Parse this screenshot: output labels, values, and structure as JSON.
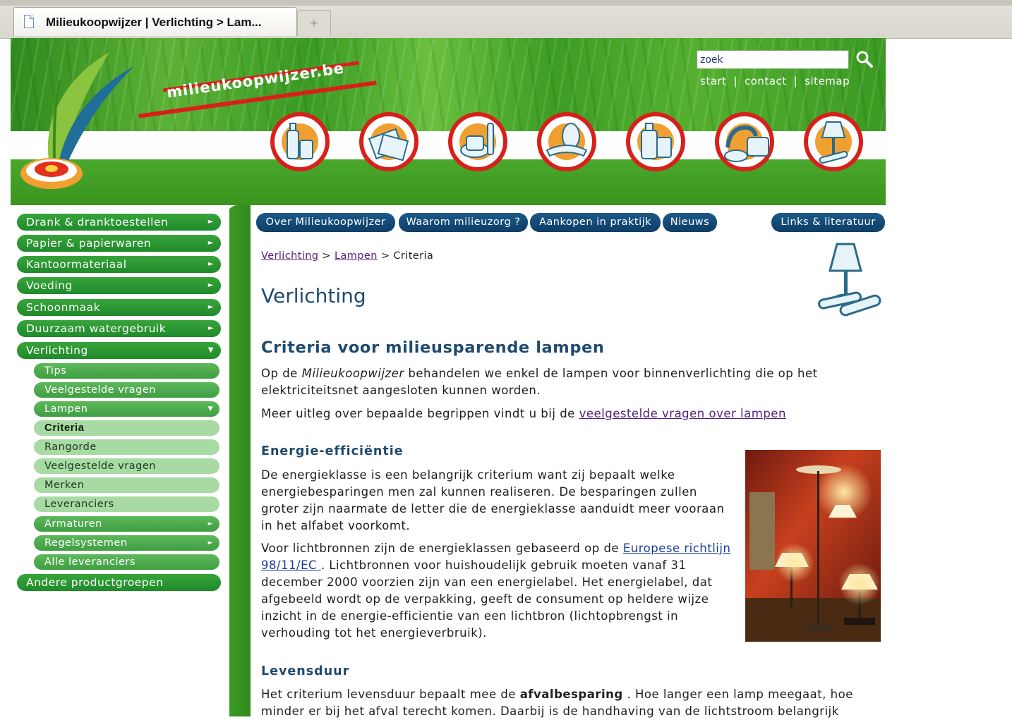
{
  "browser": {
    "tab_title": "Milieukoopwijzer | Verlichting > Lam...",
    "new_tab_symbol": "+"
  },
  "header": {
    "brand": "milieukoopwijzer.be",
    "search_value": "zoek",
    "links": [
      "start",
      "contact",
      "sitemap"
    ],
    "category_icons": [
      "drinks-icon",
      "paper-icon",
      "office-supplies-icon",
      "food-icon",
      "cleaning-icon",
      "water-icon",
      "lighting-icon"
    ]
  },
  "topnav": [
    "Over Milieukoopwijzer",
    "Waarom milieuzorg ?",
    "Aankopen in praktijk",
    "Nieuws",
    "Links & literatuur"
  ],
  "sidebar": {
    "main": [
      "Drank & dranktoestellen",
      "Papier & papierwaren",
      "Kantoormateriaal",
      "Voeding",
      "Schoonmaak",
      "Duurzaam watergebruik",
      "Verlichting"
    ],
    "sub_lighting": [
      "Tips",
      "Veelgestelde vragen",
      "Lampen"
    ],
    "sub_lampen": [
      "Criteria",
      "Rangorde",
      "Veelgestelde vragen",
      "Merken",
      "Leveranciers"
    ],
    "sub_lighting_more": [
      "Armaturen",
      "Regelsystemen",
      "Alle leveranciers"
    ],
    "other": "Andere productgroepen"
  },
  "breadcrumb": {
    "level1": "Verlichting",
    "level2": "Lampen",
    "current": "Criteria",
    "separator": ">"
  },
  "page": {
    "title": "Verlichting",
    "section_title": "Criteria voor milieusparende lampen",
    "intro_before": "Op de ",
    "intro_em": "Milieukoopwijzer",
    "intro_after": " behandelen we enkel de lampen voor binnenverlichting die op het elektriciteitsnet aangesloten kunnen worden.",
    "more_before": "Meer uitleg over bepaalde begrippen vindt u bij de ",
    "more_link": "veelgestelde vragen over lampen",
    "energy_heading": "Energie-efficiëntie",
    "energy_p1": "De energieklasse is een belangrijk criterium want zij bepaalt welke energiebesparingen men zal kunnen realiseren. De besparingen zullen groter zijn naarmate de letter die de energieklasse aanduidt meer vooraan in het alfabet voorkomt.",
    "energy_p2_before": "Voor lichtbronnen zijn de energieklassen gebaseerd op de ",
    "energy_p2_link": "Europese richtlijn 98/11/EC ",
    "energy_p2_after": ". Lichtbronnen voor huishoudelijk gebruik moeten vanaf 31 december 2000 voorzien zijn van een energielabel. Het energielabel, dat afgebeeld wordt op de verpakking, geeft de consument op heldere wijze inzicht in de energie-efficientie van een lichtbron (lichtopbrengst in verhouding tot het energieverbruik).",
    "life_heading": "Levensduur",
    "life_before": "Het criterium levensduur bepaalt mee de ",
    "life_bold": "afvalbesparing",
    "life_after": " . Hoe langer een lamp meegaat, hoe minder er bij het afval terecht komen. Daarbij is de handhaving van de lichtstroom belangrijk"
  }
}
